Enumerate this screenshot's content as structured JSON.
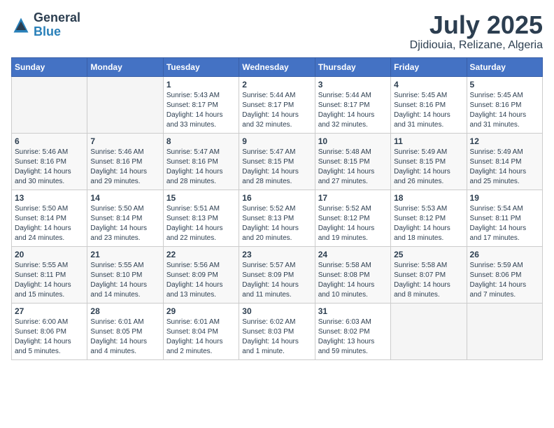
{
  "logo": {
    "general": "General",
    "blue": "Blue"
  },
  "title": {
    "month": "July 2025",
    "location": "Djidiouia, Relizane, Algeria"
  },
  "weekdays": [
    "Sunday",
    "Monday",
    "Tuesday",
    "Wednesday",
    "Thursday",
    "Friday",
    "Saturday"
  ],
  "weeks": [
    [
      {
        "day": "",
        "sunrise": "",
        "sunset": "",
        "daylight": ""
      },
      {
        "day": "",
        "sunrise": "",
        "sunset": "",
        "daylight": ""
      },
      {
        "day": "1",
        "sunrise": "Sunrise: 5:43 AM",
        "sunset": "Sunset: 8:17 PM",
        "daylight": "Daylight: 14 hours and 33 minutes."
      },
      {
        "day": "2",
        "sunrise": "Sunrise: 5:44 AM",
        "sunset": "Sunset: 8:17 PM",
        "daylight": "Daylight: 14 hours and 32 minutes."
      },
      {
        "day": "3",
        "sunrise": "Sunrise: 5:44 AM",
        "sunset": "Sunset: 8:17 PM",
        "daylight": "Daylight: 14 hours and 32 minutes."
      },
      {
        "day": "4",
        "sunrise": "Sunrise: 5:45 AM",
        "sunset": "Sunset: 8:16 PM",
        "daylight": "Daylight: 14 hours and 31 minutes."
      },
      {
        "day": "5",
        "sunrise": "Sunrise: 5:45 AM",
        "sunset": "Sunset: 8:16 PM",
        "daylight": "Daylight: 14 hours and 31 minutes."
      }
    ],
    [
      {
        "day": "6",
        "sunrise": "Sunrise: 5:46 AM",
        "sunset": "Sunset: 8:16 PM",
        "daylight": "Daylight: 14 hours and 30 minutes."
      },
      {
        "day": "7",
        "sunrise": "Sunrise: 5:46 AM",
        "sunset": "Sunset: 8:16 PM",
        "daylight": "Daylight: 14 hours and 29 minutes."
      },
      {
        "day": "8",
        "sunrise": "Sunrise: 5:47 AM",
        "sunset": "Sunset: 8:16 PM",
        "daylight": "Daylight: 14 hours and 28 minutes."
      },
      {
        "day": "9",
        "sunrise": "Sunrise: 5:47 AM",
        "sunset": "Sunset: 8:15 PM",
        "daylight": "Daylight: 14 hours and 28 minutes."
      },
      {
        "day": "10",
        "sunrise": "Sunrise: 5:48 AM",
        "sunset": "Sunset: 8:15 PM",
        "daylight": "Daylight: 14 hours and 27 minutes."
      },
      {
        "day": "11",
        "sunrise": "Sunrise: 5:49 AM",
        "sunset": "Sunset: 8:15 PM",
        "daylight": "Daylight: 14 hours and 26 minutes."
      },
      {
        "day": "12",
        "sunrise": "Sunrise: 5:49 AM",
        "sunset": "Sunset: 8:14 PM",
        "daylight": "Daylight: 14 hours and 25 minutes."
      }
    ],
    [
      {
        "day": "13",
        "sunrise": "Sunrise: 5:50 AM",
        "sunset": "Sunset: 8:14 PM",
        "daylight": "Daylight: 14 hours and 24 minutes."
      },
      {
        "day": "14",
        "sunrise": "Sunrise: 5:50 AM",
        "sunset": "Sunset: 8:14 PM",
        "daylight": "Daylight: 14 hours and 23 minutes."
      },
      {
        "day": "15",
        "sunrise": "Sunrise: 5:51 AM",
        "sunset": "Sunset: 8:13 PM",
        "daylight": "Daylight: 14 hours and 22 minutes."
      },
      {
        "day": "16",
        "sunrise": "Sunrise: 5:52 AM",
        "sunset": "Sunset: 8:13 PM",
        "daylight": "Daylight: 14 hours and 20 minutes."
      },
      {
        "day": "17",
        "sunrise": "Sunrise: 5:52 AM",
        "sunset": "Sunset: 8:12 PM",
        "daylight": "Daylight: 14 hours and 19 minutes."
      },
      {
        "day": "18",
        "sunrise": "Sunrise: 5:53 AM",
        "sunset": "Sunset: 8:12 PM",
        "daylight": "Daylight: 14 hours and 18 minutes."
      },
      {
        "day": "19",
        "sunrise": "Sunrise: 5:54 AM",
        "sunset": "Sunset: 8:11 PM",
        "daylight": "Daylight: 14 hours and 17 minutes."
      }
    ],
    [
      {
        "day": "20",
        "sunrise": "Sunrise: 5:55 AM",
        "sunset": "Sunset: 8:11 PM",
        "daylight": "Daylight: 14 hours and 15 minutes."
      },
      {
        "day": "21",
        "sunrise": "Sunrise: 5:55 AM",
        "sunset": "Sunset: 8:10 PM",
        "daylight": "Daylight: 14 hours and 14 minutes."
      },
      {
        "day": "22",
        "sunrise": "Sunrise: 5:56 AM",
        "sunset": "Sunset: 8:09 PM",
        "daylight": "Daylight: 14 hours and 13 minutes."
      },
      {
        "day": "23",
        "sunrise": "Sunrise: 5:57 AM",
        "sunset": "Sunset: 8:09 PM",
        "daylight": "Daylight: 14 hours and 11 minutes."
      },
      {
        "day": "24",
        "sunrise": "Sunrise: 5:58 AM",
        "sunset": "Sunset: 8:08 PM",
        "daylight": "Daylight: 14 hours and 10 minutes."
      },
      {
        "day": "25",
        "sunrise": "Sunrise: 5:58 AM",
        "sunset": "Sunset: 8:07 PM",
        "daylight": "Daylight: 14 hours and 8 minutes."
      },
      {
        "day": "26",
        "sunrise": "Sunrise: 5:59 AM",
        "sunset": "Sunset: 8:06 PM",
        "daylight": "Daylight: 14 hours and 7 minutes."
      }
    ],
    [
      {
        "day": "27",
        "sunrise": "Sunrise: 6:00 AM",
        "sunset": "Sunset: 8:06 PM",
        "daylight": "Daylight: 14 hours and 5 minutes."
      },
      {
        "day": "28",
        "sunrise": "Sunrise: 6:01 AM",
        "sunset": "Sunset: 8:05 PM",
        "daylight": "Daylight: 14 hours and 4 minutes."
      },
      {
        "day": "29",
        "sunrise": "Sunrise: 6:01 AM",
        "sunset": "Sunset: 8:04 PM",
        "daylight": "Daylight: 14 hours and 2 minutes."
      },
      {
        "day": "30",
        "sunrise": "Sunrise: 6:02 AM",
        "sunset": "Sunset: 8:03 PM",
        "daylight": "Daylight: 14 hours and 1 minute."
      },
      {
        "day": "31",
        "sunrise": "Sunrise: 6:03 AM",
        "sunset": "Sunset: 8:02 PM",
        "daylight": "Daylight: 13 hours and 59 minutes."
      },
      {
        "day": "",
        "sunrise": "",
        "sunset": "",
        "daylight": ""
      },
      {
        "day": "",
        "sunrise": "",
        "sunset": "",
        "daylight": ""
      }
    ]
  ]
}
